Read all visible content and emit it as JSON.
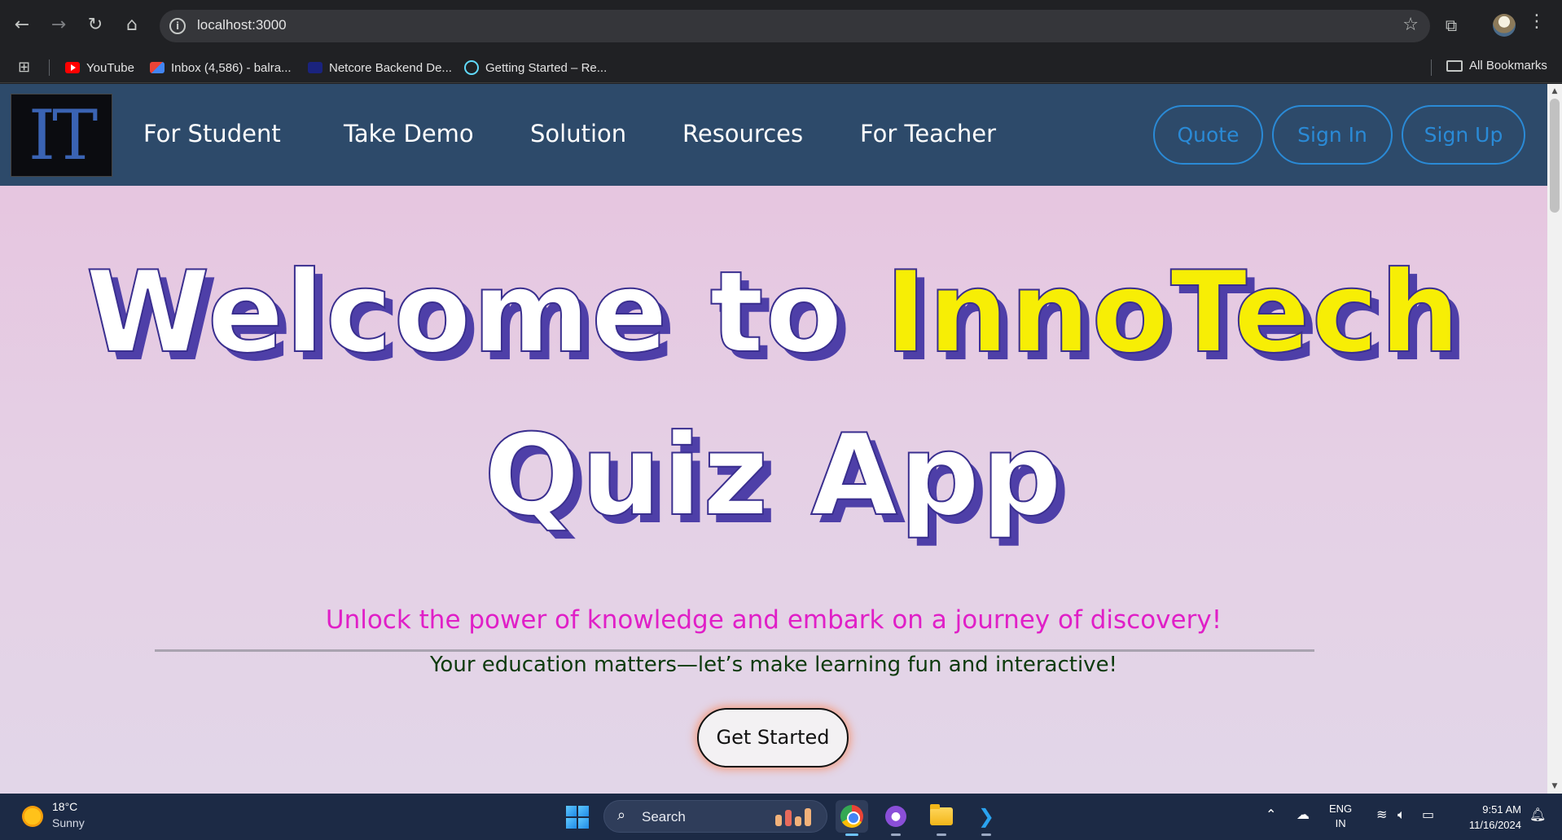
{
  "browser": {
    "url": "localhost:3000",
    "bookmarks": [
      {
        "label": "YouTube"
      },
      {
        "label": "Inbox (4,586) - balra..."
      },
      {
        "label": "Netcore Backend De..."
      },
      {
        "label": "Getting Started – Re..."
      }
    ],
    "all_bookmarks": "All Bookmarks"
  },
  "site": {
    "logo_text": "IT",
    "nav": [
      "For Student",
      "Take Demo",
      "Solution",
      "Resources",
      "For Teacher"
    ],
    "buttons": {
      "quote": "Quote",
      "sign_in": "Sign In",
      "sign_up": "Sign Up"
    },
    "hero": {
      "line1_prefix": "Welcome to ",
      "line1_accent": "InnoTech",
      "line2": "Quiz App"
    },
    "tagline": "Unlock the power of knowledge and embark on a journey of discovery!",
    "subline": "Your education matters—let’s make learning fun and interactive!",
    "cta": "Get Started"
  },
  "taskbar": {
    "temperature": "18°C",
    "condition": "Sunny",
    "search": "Search",
    "lang_line1": "ENG",
    "lang_line2": "IN",
    "time": "9:51 AM",
    "date": "11/16/2024"
  },
  "colors": {
    "nav_bg": "#2d4a6a",
    "accent_blue": "#2a8ad6",
    "hero_accent": "#f7ee05",
    "hero_shadow": "#4e3fa8",
    "tagline": "#e01fc7",
    "subline": "#0d3a0d"
  }
}
